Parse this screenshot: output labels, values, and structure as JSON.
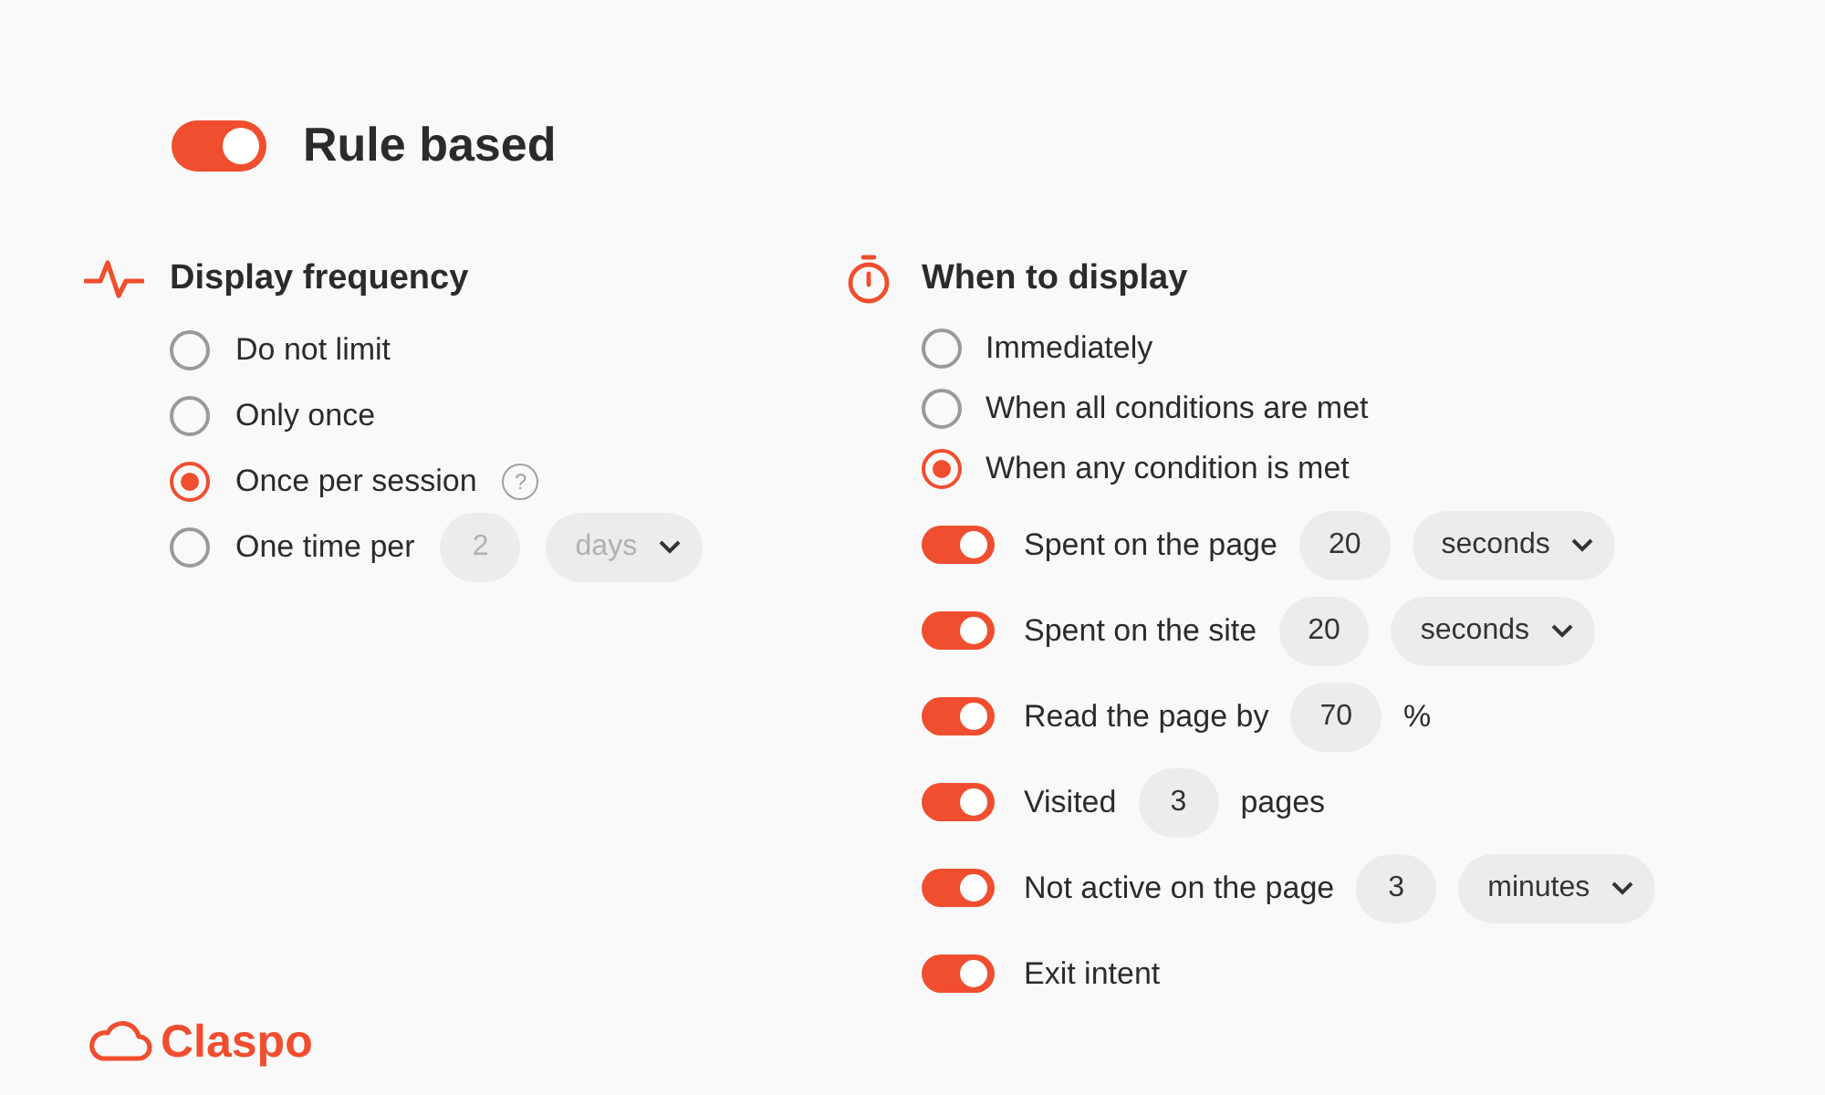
{
  "header": {
    "label": "Rule based",
    "on": true
  },
  "frequency": {
    "title": "Display frequency",
    "options": [
      {
        "label": "Do not limit",
        "selected": false
      },
      {
        "label": "Only once",
        "selected": false
      },
      {
        "label": "Once per session",
        "selected": true,
        "help": "?"
      },
      {
        "label": "One time per",
        "selected": false,
        "value": "2",
        "unit": "days",
        "disabled": true
      }
    ]
  },
  "display": {
    "title": "When to display",
    "options": [
      {
        "label": "Immediately",
        "selected": false
      },
      {
        "label": "When all conditions are met",
        "selected": false
      },
      {
        "label": "When any condition is met",
        "selected": true
      }
    ],
    "conditions": [
      {
        "label": "Spent on the page",
        "on": true,
        "value": "20",
        "unit": "seconds"
      },
      {
        "label": "Spent on the site",
        "on": true,
        "value": "20",
        "unit": "seconds"
      },
      {
        "label": "Read the page by",
        "on": true,
        "value": "70",
        "suffix": "%"
      },
      {
        "label": "Visited",
        "on": true,
        "value": "3",
        "suffix": "pages"
      },
      {
        "label": "Not active on the page",
        "on": true,
        "value": "3",
        "unit": "minutes"
      },
      {
        "label": "Exit intent",
        "on": true
      }
    ]
  },
  "logo": {
    "name": "Claspo"
  }
}
